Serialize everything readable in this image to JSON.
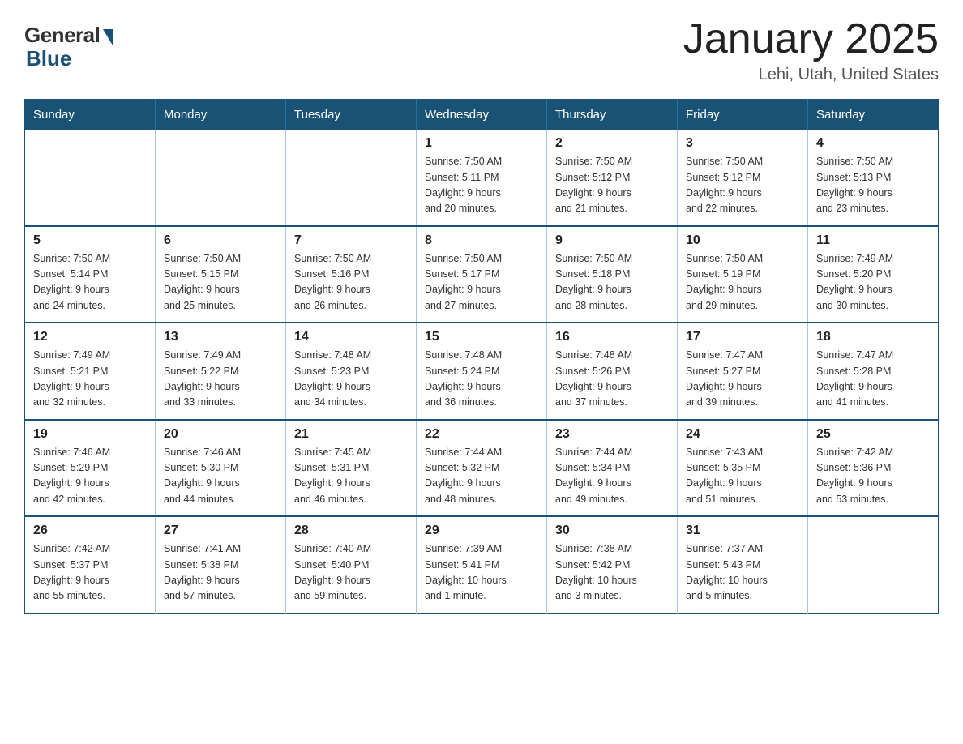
{
  "header": {
    "logo_general": "General",
    "logo_blue": "Blue",
    "month_title": "January 2025",
    "location": "Lehi, Utah, United States"
  },
  "days_of_week": [
    "Sunday",
    "Monday",
    "Tuesday",
    "Wednesday",
    "Thursday",
    "Friday",
    "Saturday"
  ],
  "weeks": [
    [
      {
        "day": "",
        "info": ""
      },
      {
        "day": "",
        "info": ""
      },
      {
        "day": "",
        "info": ""
      },
      {
        "day": "1",
        "info": "Sunrise: 7:50 AM\nSunset: 5:11 PM\nDaylight: 9 hours\nand 20 minutes."
      },
      {
        "day": "2",
        "info": "Sunrise: 7:50 AM\nSunset: 5:12 PM\nDaylight: 9 hours\nand 21 minutes."
      },
      {
        "day": "3",
        "info": "Sunrise: 7:50 AM\nSunset: 5:12 PM\nDaylight: 9 hours\nand 22 minutes."
      },
      {
        "day": "4",
        "info": "Sunrise: 7:50 AM\nSunset: 5:13 PM\nDaylight: 9 hours\nand 23 minutes."
      }
    ],
    [
      {
        "day": "5",
        "info": "Sunrise: 7:50 AM\nSunset: 5:14 PM\nDaylight: 9 hours\nand 24 minutes."
      },
      {
        "day": "6",
        "info": "Sunrise: 7:50 AM\nSunset: 5:15 PM\nDaylight: 9 hours\nand 25 minutes."
      },
      {
        "day": "7",
        "info": "Sunrise: 7:50 AM\nSunset: 5:16 PM\nDaylight: 9 hours\nand 26 minutes."
      },
      {
        "day": "8",
        "info": "Sunrise: 7:50 AM\nSunset: 5:17 PM\nDaylight: 9 hours\nand 27 minutes."
      },
      {
        "day": "9",
        "info": "Sunrise: 7:50 AM\nSunset: 5:18 PM\nDaylight: 9 hours\nand 28 minutes."
      },
      {
        "day": "10",
        "info": "Sunrise: 7:50 AM\nSunset: 5:19 PM\nDaylight: 9 hours\nand 29 minutes."
      },
      {
        "day": "11",
        "info": "Sunrise: 7:49 AM\nSunset: 5:20 PM\nDaylight: 9 hours\nand 30 minutes."
      }
    ],
    [
      {
        "day": "12",
        "info": "Sunrise: 7:49 AM\nSunset: 5:21 PM\nDaylight: 9 hours\nand 32 minutes."
      },
      {
        "day": "13",
        "info": "Sunrise: 7:49 AM\nSunset: 5:22 PM\nDaylight: 9 hours\nand 33 minutes."
      },
      {
        "day": "14",
        "info": "Sunrise: 7:48 AM\nSunset: 5:23 PM\nDaylight: 9 hours\nand 34 minutes."
      },
      {
        "day": "15",
        "info": "Sunrise: 7:48 AM\nSunset: 5:24 PM\nDaylight: 9 hours\nand 36 minutes."
      },
      {
        "day": "16",
        "info": "Sunrise: 7:48 AM\nSunset: 5:26 PM\nDaylight: 9 hours\nand 37 minutes."
      },
      {
        "day": "17",
        "info": "Sunrise: 7:47 AM\nSunset: 5:27 PM\nDaylight: 9 hours\nand 39 minutes."
      },
      {
        "day": "18",
        "info": "Sunrise: 7:47 AM\nSunset: 5:28 PM\nDaylight: 9 hours\nand 41 minutes."
      }
    ],
    [
      {
        "day": "19",
        "info": "Sunrise: 7:46 AM\nSunset: 5:29 PM\nDaylight: 9 hours\nand 42 minutes."
      },
      {
        "day": "20",
        "info": "Sunrise: 7:46 AM\nSunset: 5:30 PM\nDaylight: 9 hours\nand 44 minutes."
      },
      {
        "day": "21",
        "info": "Sunrise: 7:45 AM\nSunset: 5:31 PM\nDaylight: 9 hours\nand 46 minutes."
      },
      {
        "day": "22",
        "info": "Sunrise: 7:44 AM\nSunset: 5:32 PM\nDaylight: 9 hours\nand 48 minutes."
      },
      {
        "day": "23",
        "info": "Sunrise: 7:44 AM\nSunset: 5:34 PM\nDaylight: 9 hours\nand 49 minutes."
      },
      {
        "day": "24",
        "info": "Sunrise: 7:43 AM\nSunset: 5:35 PM\nDaylight: 9 hours\nand 51 minutes."
      },
      {
        "day": "25",
        "info": "Sunrise: 7:42 AM\nSunset: 5:36 PM\nDaylight: 9 hours\nand 53 minutes."
      }
    ],
    [
      {
        "day": "26",
        "info": "Sunrise: 7:42 AM\nSunset: 5:37 PM\nDaylight: 9 hours\nand 55 minutes."
      },
      {
        "day": "27",
        "info": "Sunrise: 7:41 AM\nSunset: 5:38 PM\nDaylight: 9 hours\nand 57 minutes."
      },
      {
        "day": "28",
        "info": "Sunrise: 7:40 AM\nSunset: 5:40 PM\nDaylight: 9 hours\nand 59 minutes."
      },
      {
        "day": "29",
        "info": "Sunrise: 7:39 AM\nSunset: 5:41 PM\nDaylight: 10 hours\nand 1 minute."
      },
      {
        "day": "30",
        "info": "Sunrise: 7:38 AM\nSunset: 5:42 PM\nDaylight: 10 hours\nand 3 minutes."
      },
      {
        "day": "31",
        "info": "Sunrise: 7:37 AM\nSunset: 5:43 PM\nDaylight: 10 hours\nand 5 minutes."
      },
      {
        "day": "",
        "info": ""
      }
    ]
  ]
}
